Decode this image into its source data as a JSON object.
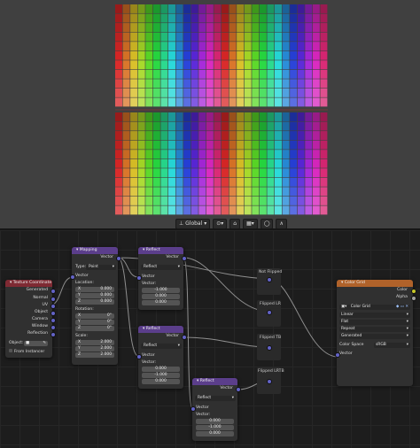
{
  "header": {
    "orientation": "Global",
    "orientation_icon": "orientation-icon",
    "snap_icon": "snap-icon",
    "proportional_icon": "proportional-icon"
  },
  "grid": {
    "rows": 22,
    "cols": 28,
    "labels": [
      "A",
      "B",
      "C",
      "D",
      "E",
      "F",
      "G",
      "H"
    ]
  },
  "texture_coordinate": {
    "title": "Texture Coordinate",
    "outputs": [
      "Generated",
      "Normal",
      "UV",
      "Object",
      "Camera",
      "Window",
      "Reflection"
    ],
    "object_label": "Object:",
    "from_instancer": "From Instancer"
  },
  "mapping": {
    "title": "Mapping",
    "out": "Vector",
    "type_label": "Type:",
    "type_value": "Point",
    "in": "Vector",
    "location_label": "Location:",
    "location": [
      [
        "X",
        "0.000"
      ],
      [
        "Y",
        "0.000"
      ],
      [
        "Z",
        "0.000"
      ]
    ],
    "rotation_label": "Rotation:",
    "rotation": [
      [
        "X",
        "0°"
      ],
      [
        "Y",
        "0°"
      ],
      [
        "Z",
        "0°"
      ]
    ],
    "scale_label": "Scale:",
    "scale": [
      [
        "X",
        "2.000"
      ],
      [
        "Y",
        "2.000"
      ],
      [
        "Z",
        "2.000"
      ]
    ]
  },
  "reflect1": {
    "title": "Reflect",
    "out": "Vector",
    "mode": "Reflect",
    "in": "Vector",
    "vec_label": "Vector:",
    "vals": [
      "-1.000",
      "0.000",
      "0.000"
    ]
  },
  "reflect2": {
    "title": "Reflect",
    "out": "Vector",
    "mode": "Reflect",
    "in": "Vector",
    "vec_label": "Vector:",
    "vals": [
      "0.000",
      "-1.000",
      "0.000"
    ]
  },
  "reflect3": {
    "title": "Reflect",
    "out": "Vector",
    "mode": "Reflect",
    "in": "Vector",
    "vec_label": "Vector:",
    "vals": [
      "0.000",
      "-1.000",
      "0.000"
    ]
  },
  "reroutes": [
    "Not Flipped",
    "Flipped LR",
    "Flipped TB",
    "Flipped LRTB"
  ],
  "image_texture": {
    "title": "Color Grid",
    "out_color": "Color",
    "out_alpha": "Alpha",
    "image_name": "Color Grid",
    "interpolation": "Linear",
    "projection": "Flat",
    "extension": "Repeat",
    "source": "Generated",
    "cs_label": "Color Space",
    "cs_value": "sRGB",
    "in": "Vector"
  },
  "colors": {
    "vector_socket": "#6363c7",
    "color_socket": "#c7c729",
    "mapping_header": "#5b3e8b",
    "texcoord_header": "#7f2a33",
    "image_header": "#b0622a"
  }
}
